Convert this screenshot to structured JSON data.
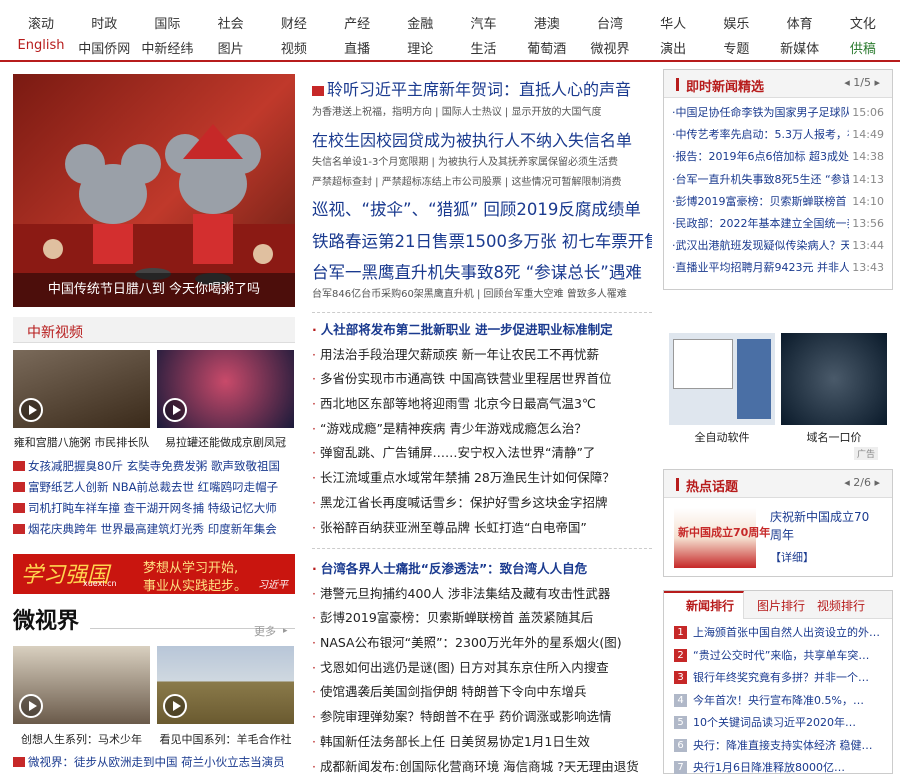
{
  "nav": {
    "row1": [
      "滚动",
      "时政",
      "国际",
      "社会",
      "财经",
      "产经",
      "金融",
      "汽车",
      "港澳",
      "台湾",
      "华人",
      "娱乐",
      "体育",
      "文化"
    ],
    "row2": [
      "English",
      "中国侨网",
      "中新经纬",
      "图片",
      "视频",
      "直播",
      "理论",
      "生活",
      "葡萄酒",
      "微视界",
      "演出",
      "专题",
      "新媒体",
      "供稿"
    ]
  },
  "hero": {
    "caption": "中国传统节日腊八到  今天你喝粥了吗"
  },
  "headlines": {
    "h1": "聆听习近平主席新年贺词：直抵人心的声音",
    "h1_sub": "为香港送上祝福，指明方向 | 国际人士热议 | 显示开放的大国气度",
    "h2": "在校生因校园贷成为被执行人不纳入失信名单",
    "h2_sub1": "失信名单设1-3个月宽限期 | 为被执行人及其抚养家属保留必须生活费",
    "h2_sub2": "严禁超标查封 | 严禁超标冻结上市公司股票 | 这些情况可暂解限制消费",
    "h3": "巡视、“拔伞”、“猎狐” 回顾2019反腐成绩单",
    "h4": "铁路春运第21日售票1500多万张 初七车票开售",
    "h5": "台军一黑鹰直升机失事致8死  “参谋总长”遇难",
    "h5_sub": "台军846亿台币采购60架黑鹰直升机 | 回顾台军重大空难 曾致多人罹难"
  },
  "list1": [
    "人社部将发布第二批新职业  进一步促进职业标准制定",
    "用法治手段治理欠薪顽疾  新一年让农民工不再忧薪",
    "多省份实现市市通高铁  中国高铁营业里程居世界首位",
    "西北地区东部等地将迎雨雪  北京今日最高气温3℃",
    "“游戏成瘾”是精神疾病  青少年游戏成瘾怎么治？",
    "弹窗乱跳、广告铺屏……安宁权入法世界“清静”了",
    "长江流域重点水域常年禁捕  28万渔民生计如何保障？",
    "黑龙江省长再度喊话雪乡：保护好雪乡这块金字招牌",
    "张裕醉百纳获亚洲至尊品牌  长虹打造“白电帝国”"
  ],
  "list2": [
    "台湾各界人士痛批“反渗透法”：致台湾人人自危",
    "港警元旦拘捕约400人  涉非法集结及藏有攻击性武器",
    "彭博2019富豪榜：贝索斯蝉联榜首  盖茨紧随其后",
    "NASA公布银河“美照”：2300万光年外的星系烟火(图)",
    "戈恩如何出逃仍是谜(图) 日方对其东京住所入内搜查",
    "使馆遇袭后美国剑指伊朗  特朗普下令向中东增兵",
    "参院审理弹劾案？特朗普不在乎  药价调涨或影响选情",
    "韩国新任法务部长上任  日美贸易协定1月1日生效",
    "成都新闻发布:创国际化营商环境  海信商城 ?天无理由退货"
  ],
  "video": {
    "title": "中新视频",
    "cap1": "雍和宫腊八施粥 市民排长队",
    "cap2": "易拉罐还能做成京剧凤冠",
    "items": [
      "女孩减肥握臭80斤  玄奘寺免费发粥  歌声致敬祖国",
      "富野纸艺人创新  NBA前总裁去世  红嘴鸥叼走帽子",
      "司机打盹车祥车撞  查干湖开网冬捕  特级记忆大师",
      "烟花庆典跨年  世界最高建筑灯光秀  印度新年集会"
    ]
  },
  "banner": {
    "logo": "学习强国",
    "sub": "xuexi.cn",
    "slogan1": "梦想从学习开始,",
    "slogan2": "事业从实践起步。",
    "sign": "习近平"
  },
  "weishijie": {
    "title": "微视界",
    "more": "更多",
    "cap1": "创想人生系列：马术少年",
    "cap2": "看见中国系列：羊毛合作社",
    "item": "微视界：徒步从欧洲走到中国  荷兰小伙立志当演员"
  },
  "instant": {
    "title": "即时新闻精选",
    "page": "1/5",
    "items": [
      {
        "t": "·中国足协任命李铁为国家男子足球队",
        "tm": "15:06"
      },
      {
        "t": "·中传艺考率先启动：5.3万人报考，初",
        "tm": "14:49"
      },
      {
        "t": "·报告：2019年6点6倍加标  超3成处于",
        "tm": "14:38"
      },
      {
        "t": "·台军一直升机失事致8死5生还 “参谋",
        "tm": "14:13"
      },
      {
        "t": "·彭博2019富豪榜：贝索斯蝉联榜首  盖",
        "tm": "14:10"
      },
      {
        "t": "·民政部：2022年基本建立全国统一养",
        "tm": "13:56"
      },
      {
        "t": "·武汉出港航班发现疑似传染病人？天",
        "tm": "13:44"
      },
      {
        "t": "·直播业平均招聘月薪9423元  并非人人",
        "tm": "13:43"
      }
    ]
  },
  "ads": {
    "cap1": "全自动软件",
    "cap2": "域名一口价",
    "label": "广告"
  },
  "hot": {
    "title": "热点话题",
    "page": "2/6",
    "text": "庆祝新中国成立70周年",
    "link": "【详细】",
    "img_text": "新中国成立70周年"
  },
  "rank": {
    "tabs": [
      "新闻排行",
      "图片排行",
      "视频排行"
    ],
    "items": [
      "上海颁首张中国自然人出资设立的外…",
      "“贵过公交时代”来临，共享单车突…",
      "银行年终奖究竟有多拼？并非一个…",
      "今年首次！央行宣布降准0.5%，…",
      "10个关键词品读习近平2020年…",
      "央行：降准直接支持实体经济  稳健…",
      "央行1月6日降准释放8000亿…"
    ]
  }
}
